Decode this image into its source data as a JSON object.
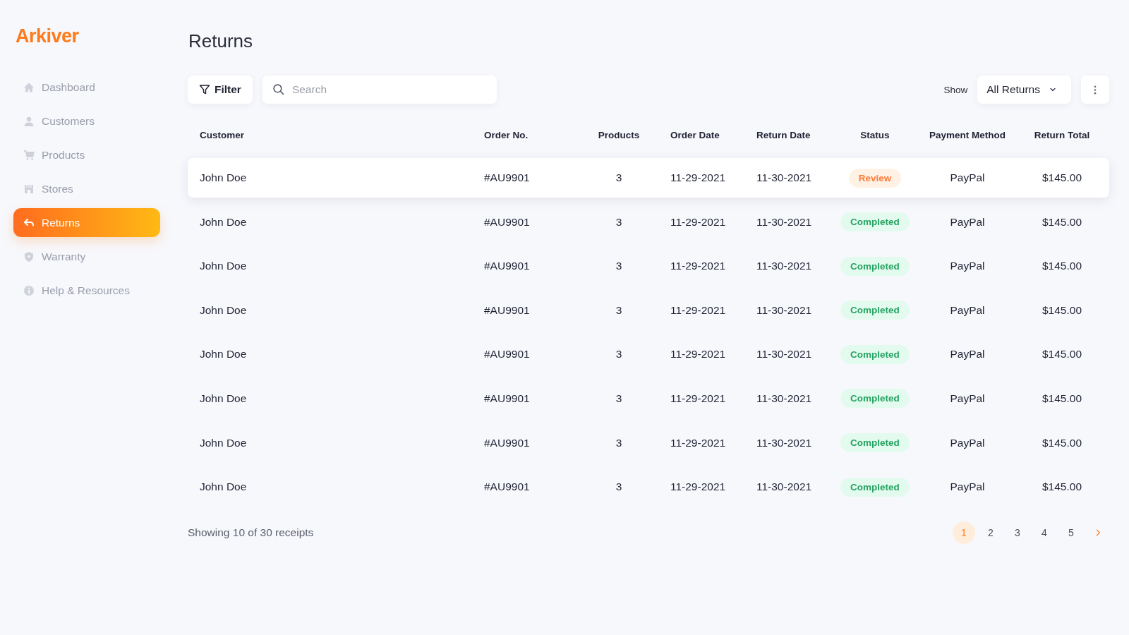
{
  "brand": {
    "name": "Arkiver"
  },
  "sidebar": {
    "items": [
      {
        "label": "Dashboard",
        "kind": "home",
        "selected": false
      },
      {
        "label": "Customers",
        "kind": "person",
        "selected": false
      },
      {
        "label": "Products",
        "kind": "cart",
        "selected": false
      },
      {
        "label": "Stores",
        "kind": "store",
        "selected": false
      },
      {
        "label": "Returns",
        "kind": "return",
        "selected": true
      },
      {
        "label": "Warranty",
        "kind": "shield",
        "selected": false
      },
      {
        "label": "Help & Resources",
        "kind": "info",
        "selected": false
      }
    ]
  },
  "page_title": "Returns",
  "toolbar": {
    "filter_label": "Filter",
    "search": {
      "placeholder": "Search"
    },
    "show_label": "Show",
    "show_value": "All Returns"
  },
  "table": {
    "columns": [
      "Customer",
      "Order No.",
      "Products",
      "Order Date",
      "Return Date",
      "Status",
      "Payment Method",
      "Return Total"
    ],
    "rows": [
      {
        "selected": true,
        "customer": "John Doe",
        "order_no": "#AU9901",
        "products": "3",
        "order_date": "11-29-2021",
        "return_date": "11-30-2021",
        "status": {
          "label": "Review",
          "kind": "review"
        },
        "payment": "PayPal",
        "total": "$145.00"
      },
      {
        "selected": false,
        "customer": "John Doe",
        "order_no": "#AU9901",
        "products": "3",
        "order_date": "11-29-2021",
        "return_date": "11-30-2021",
        "status": {
          "label": "Completed",
          "kind": "completed"
        },
        "payment": "PayPal",
        "total": "$145.00"
      },
      {
        "selected": false,
        "customer": "John Doe",
        "order_no": "#AU9901",
        "products": "3",
        "order_date": "11-29-2021",
        "return_date": "11-30-2021",
        "status": {
          "label": "Completed",
          "kind": "completed"
        },
        "payment": "PayPal",
        "total": "$145.00"
      },
      {
        "selected": false,
        "customer": "John Doe",
        "order_no": "#AU9901",
        "products": "3",
        "order_date": "11-29-2021",
        "return_date": "11-30-2021",
        "status": {
          "label": "Completed",
          "kind": "completed"
        },
        "payment": "PayPal",
        "total": "$145.00"
      },
      {
        "selected": false,
        "customer": "John Doe",
        "order_no": "#AU9901",
        "products": "3",
        "order_date": "11-29-2021",
        "return_date": "11-30-2021",
        "status": {
          "label": "Completed",
          "kind": "completed"
        },
        "payment": "PayPal",
        "total": "$145.00"
      },
      {
        "selected": false,
        "customer": "John Doe",
        "order_no": "#AU9901",
        "products": "3",
        "order_date": "11-29-2021",
        "return_date": "11-30-2021",
        "status": {
          "label": "Completed",
          "kind": "completed"
        },
        "payment": "PayPal",
        "total": "$145.00"
      },
      {
        "selected": false,
        "customer": "John Doe",
        "order_no": "#AU9901",
        "products": "3",
        "order_date": "11-29-2021",
        "return_date": "11-30-2021",
        "status": {
          "label": "Completed",
          "kind": "completed"
        },
        "payment": "PayPal",
        "total": "$145.00"
      },
      {
        "selected": false,
        "customer": "John Doe",
        "order_no": "#AU9901",
        "products": "3",
        "order_date": "11-29-2021",
        "return_date": "11-30-2021",
        "status": {
          "label": "Completed",
          "kind": "completed"
        },
        "payment": "PayPal",
        "total": "$145.00"
      }
    ]
  },
  "footer": {
    "summary": "Showing 10 of 30 receipts",
    "pages": [
      {
        "label": "1",
        "selected": true
      },
      {
        "label": "2",
        "selected": false
      },
      {
        "label": "3",
        "selected": false
      },
      {
        "label": "4",
        "selected": false
      },
      {
        "label": "5",
        "selected": false
      }
    ]
  }
}
